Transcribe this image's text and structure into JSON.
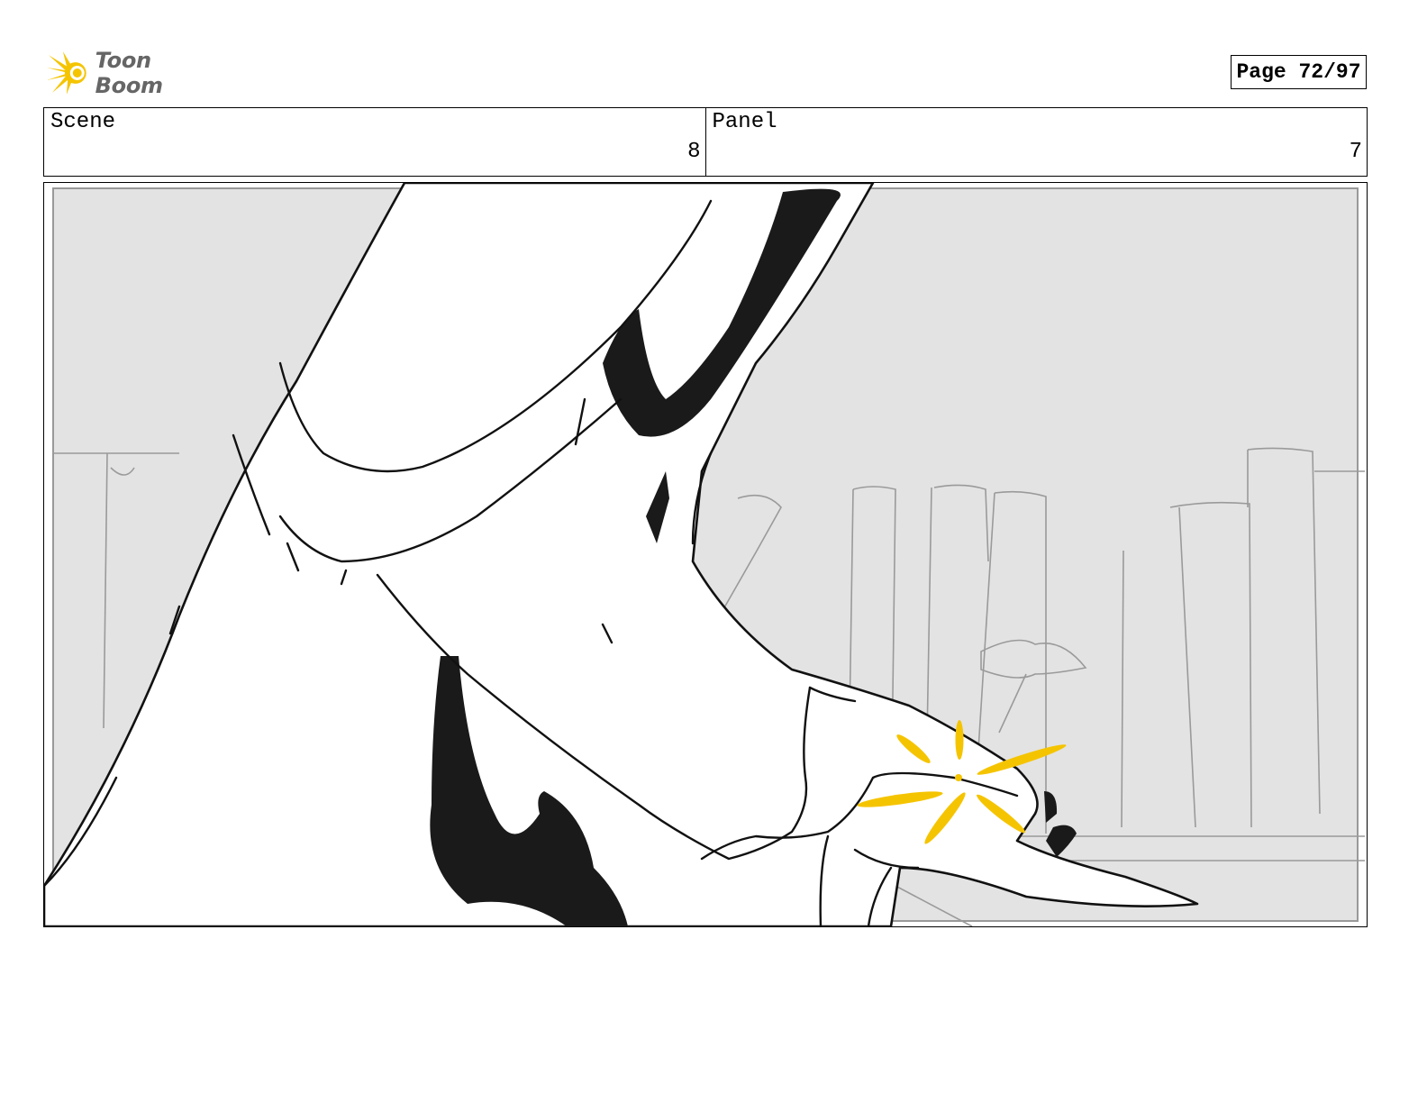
{
  "header": {
    "logo_text": "Toon Boom",
    "logo_icon": "starburst-icon",
    "page_indicator": "Page 72/97"
  },
  "info": {
    "scene_label": "Scene",
    "scene_value": "8",
    "panel_label": "Panel",
    "panel_value": "7"
  },
  "colors": {
    "accent_yellow": "#f5c400",
    "background_gray": "#e3e3e3",
    "ink": "#1a1a1a",
    "logo_text": "#666666"
  }
}
